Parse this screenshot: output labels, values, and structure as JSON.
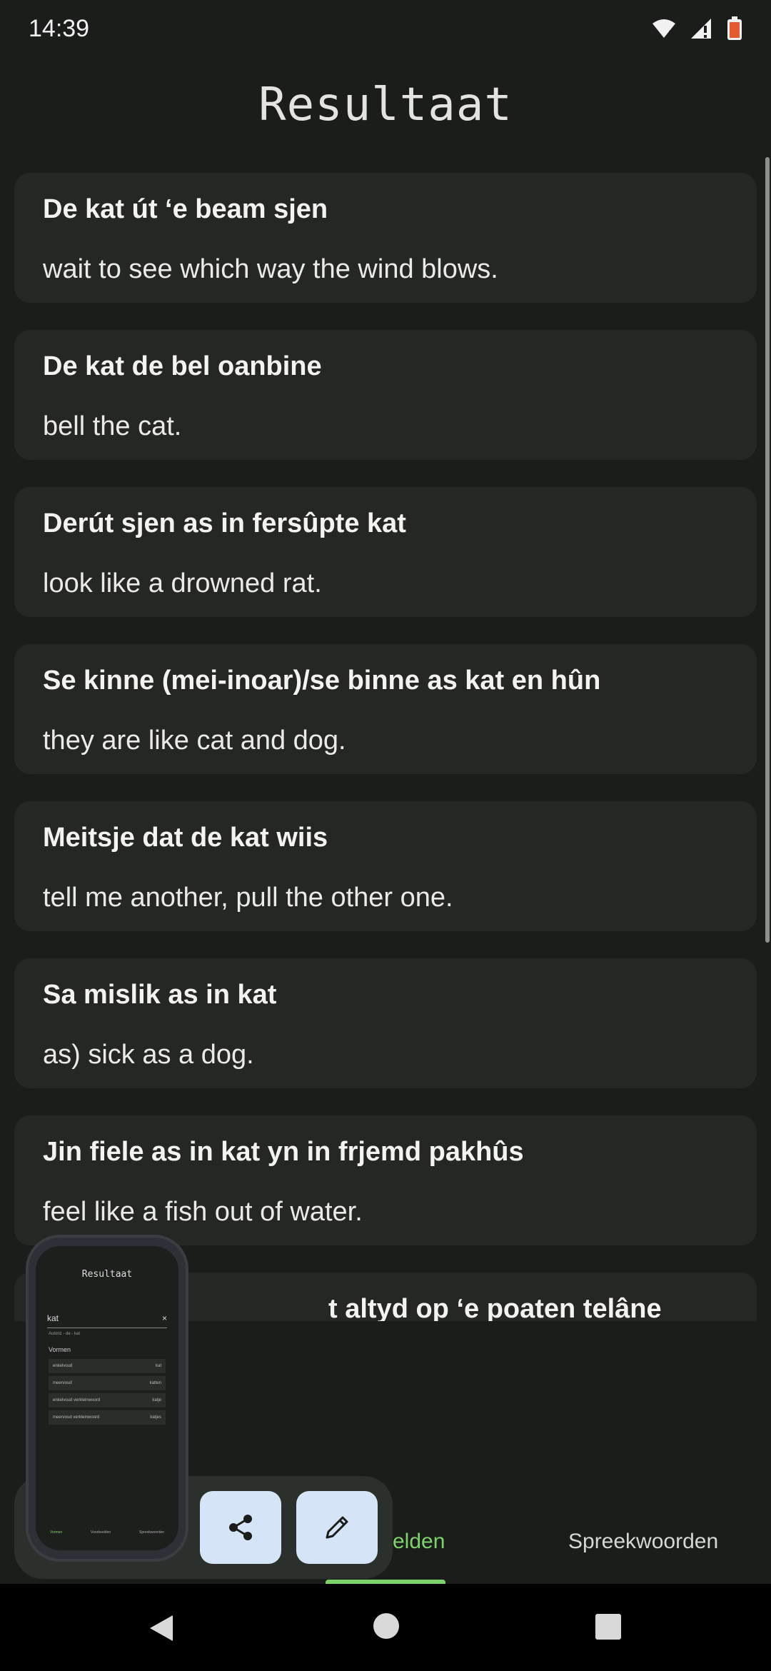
{
  "status_bar": {
    "time": "14:39",
    "icons": [
      "wifi-icon",
      "signal-icon",
      "battery-icon"
    ]
  },
  "screen_title": "Resultaat",
  "results": [
    {
      "phrase": "De kat út ‘e beam sjen",
      "meaning": "wait to see which way the wind blows."
    },
    {
      "phrase": "De kat de bel oanbine",
      "meaning": "bell the cat."
    },
    {
      "phrase": "Derút sjen as in fersûpte kat",
      "meaning": "look like a drowned rat."
    },
    {
      "phrase": "Se kinne (mei-inoar)/se binne as kat en hûn",
      "meaning": "they are like cat and dog."
    },
    {
      "phrase": "Meitsje dat de kat wiis",
      "meaning": "tell me another, pull the other one."
    },
    {
      "phrase": "Sa mislik as in kat",
      "meaning": "as) sick as a dog."
    },
    {
      "phrase": "Jin fiele as in kat yn in frjemd pakhûs",
      "meaning": "feel like a fish out of water."
    },
    {
      "phrase": "t altyd op ‘e poaten telâne",
      "meaning": ""
    }
  ],
  "bottom_nav": {
    "tab_partial": "elden",
    "tab_proverbs": "Spreekwoorden",
    "active_color": "#7ed26a"
  },
  "fabs": {
    "share_icon": "share-icon",
    "edit_icon": "pencil-icon"
  },
  "thumbnail": {
    "title": "Resultaat",
    "search_value": "kat",
    "clear": "×",
    "hint": "Autoriz - de - kat",
    "section": "Vormen",
    "rows": [
      {
        "label": "enkelvoud",
        "value": "kat"
      },
      {
        "label": "meervoud",
        "value": "katten"
      },
      {
        "label": "enkelvoud verkleinwoord",
        "value": "katje"
      },
      {
        "label": "meervoud verkleinwoord",
        "value": "katjes"
      }
    ],
    "tabs": [
      "Vormen",
      "Voorbeelden",
      "Spreekwoorden"
    ]
  },
  "colors": {
    "background": "#1b1d1b",
    "card": "#242724",
    "fab": "#d6e4f7"
  }
}
